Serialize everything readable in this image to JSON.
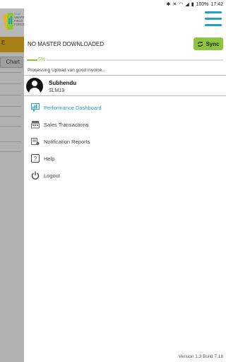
{
  "status_bar": {
    "battery": "100%",
    "time": "17:42"
  },
  "background": {
    "strip_label": "E",
    "chart_label": "Chart"
  },
  "logo": {
    "line1": "Forum",
    "line2": "SMART",
    "line3": "FIELD",
    "line4": "FORCE"
  },
  "drawer": {
    "master_status": "NO MASTER DOWNLOADED",
    "sync_label": "Sync",
    "progress_percent": 6,
    "progress_label": "6%",
    "processing_text": "Processing Upload van good invoice...",
    "user": {
      "name": "Subhendu",
      "code": "SLM19"
    },
    "menu": [
      {
        "label": "Performance Dashboard",
        "icon": "dashboard-icon",
        "active": true
      },
      {
        "label": "Sales Transactions",
        "icon": "cash-register-icon",
        "active": false
      },
      {
        "label": "Notification Reports",
        "icon": "notification-report-icon",
        "active": false
      },
      {
        "label": "Help",
        "icon": "help-icon",
        "active": false
      },
      {
        "label": "Logout",
        "icon": "power-icon",
        "active": false
      }
    ],
    "version": "Version 1.3 Build 7.18"
  },
  "colors": {
    "accent": "#1e9ec4",
    "sync": "#8cc63f",
    "strip": "#e8b220"
  }
}
